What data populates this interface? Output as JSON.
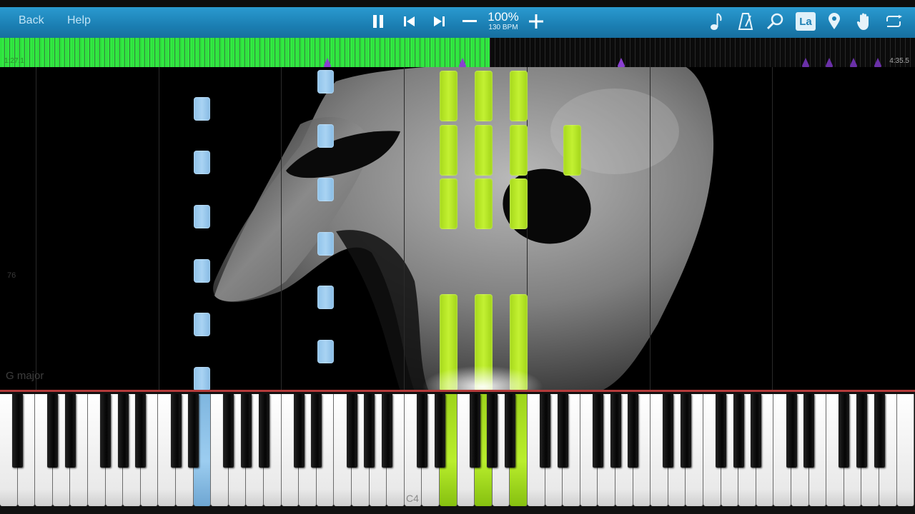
{
  "toolbar": {
    "back_label": "Back",
    "help_label": "Help",
    "speed": "100%",
    "bpm": "130 BPM",
    "icons": [
      "pause-icon",
      "skip-previous-icon",
      "skip-next-icon",
      "minus-icon",
      "plus-icon",
      "music-note-icon",
      "metronome-icon",
      "search-icon",
      "note-label-icon",
      "location-pin-icon",
      "hand-icon",
      "loop-icon"
    ],
    "note_label_text": "La"
  },
  "progress": {
    "fraction": 0.535,
    "time_elapsed": "1:27.1",
    "time_total": "4:35.5",
    "color": "#33e843",
    "marker_color": "#8a3fd1"
  },
  "notes_area": {
    "measure_number": "76",
    "key_signature": "G major"
  },
  "keyboard": {
    "c4_label": "C4",
    "highlight_green": "#b5ea2a",
    "highlight_blue": "#8fc4ec"
  }
}
